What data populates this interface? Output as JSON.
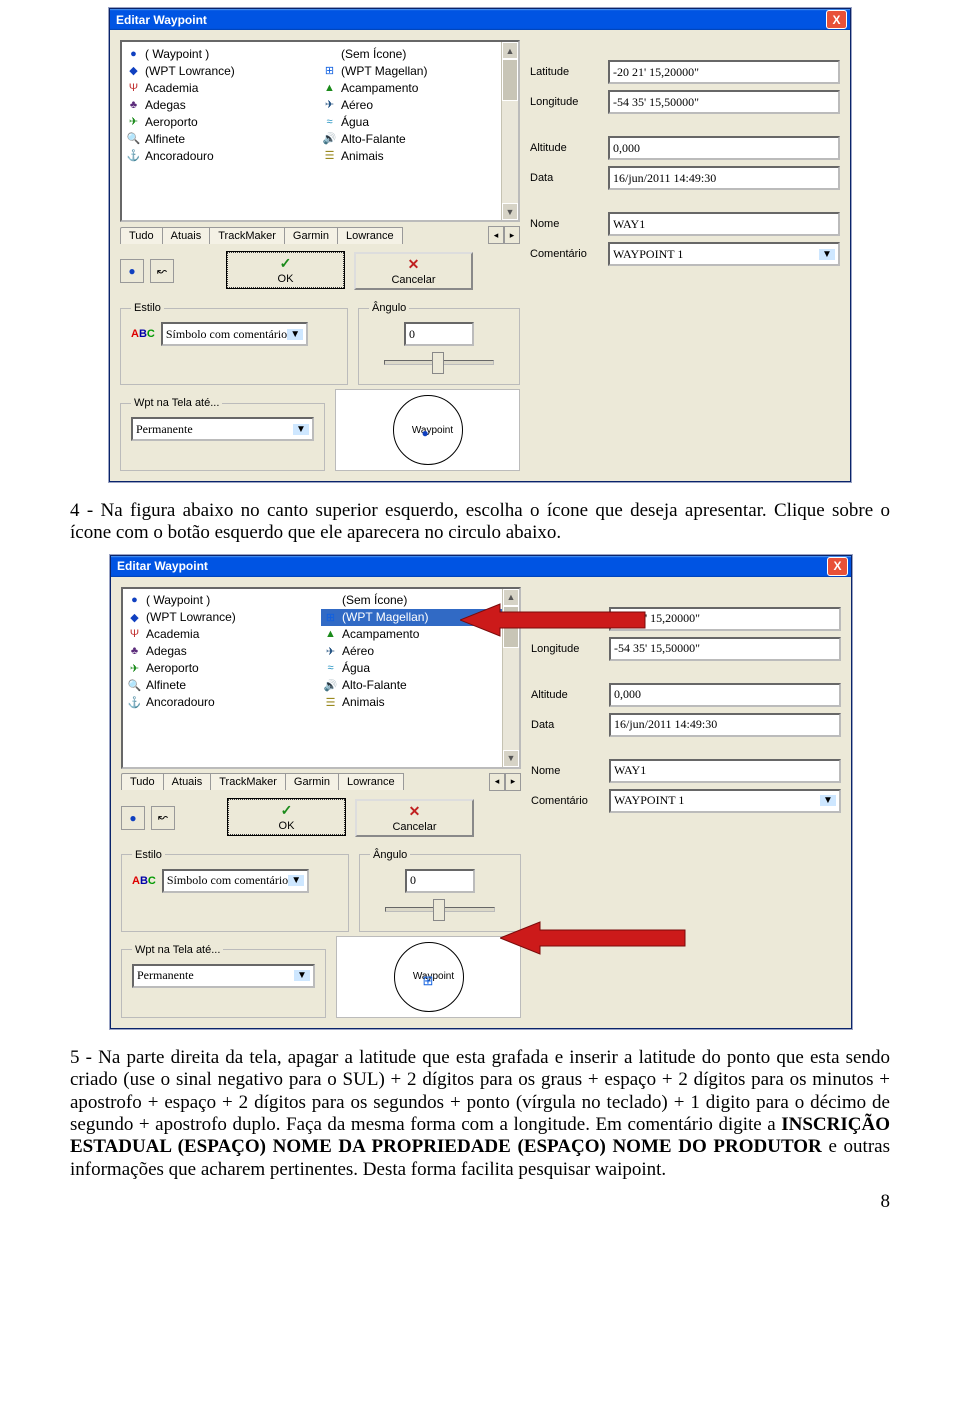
{
  "dialog": {
    "title": "Editar Waypoint",
    "close": "X",
    "iconList": [
      {
        "l_icon": "●",
        "l_label": "( Waypoint )",
        "l_color": "#1040c0",
        "r_icon": "",
        "r_label": "(Sem Ícone)",
        "r_color": ""
      },
      {
        "l_icon": "◆",
        "l_label": "(WPT Lowrance)",
        "l_color": "#1040c0",
        "r_icon": "⊞",
        "r_label": "(WPT Magellan)",
        "r_color": "#1060e0"
      },
      {
        "l_icon": "Ψ",
        "l_label": "Academia",
        "l_color": "#c03030",
        "r_icon": "▲",
        "r_label": "Acampamento",
        "r_color": "#1a8a1a"
      },
      {
        "l_icon": "♣",
        "l_label": "Adegas",
        "l_color": "#5a2a7a",
        "r_icon": "✈",
        "r_label": "Aéreo",
        "r_color": "#205080"
      },
      {
        "l_icon": "✈",
        "l_label": "Aeroporto",
        "l_color": "#1a8a1a",
        "r_icon": "≈",
        "r_label": "Água",
        "r_color": "#2090c0"
      },
      {
        "l_icon": "🔍",
        "l_label": "Alfinete",
        "l_color": "#c02020",
        "r_icon": "🔊",
        "r_label": "Alto-Falante",
        "r_color": "#2a9a2a"
      },
      {
        "l_icon": "⚓",
        "l_label": "Ancoradouro",
        "l_color": "#1040a0",
        "r_icon": "☰",
        "r_label": "Animais",
        "r_color": "#9a8a20"
      }
    ],
    "tabs": [
      "Tudo",
      "Atuais",
      "TrackMaker",
      "Garmin",
      "Lowrance"
    ],
    "ok": "OK",
    "cancel": "Cancelar",
    "form": {
      "latitude_label": "Latitude",
      "latitude_value": "-20 21' 15,20000\"",
      "longitude_label": "Longitude",
      "longitude_value": "-54 35' 15,50000\"",
      "altitude_label": "Altitude",
      "altitude_value": "0,000",
      "data_label": "Data",
      "data_value": "16/jun/2011 14:49:30",
      "nome_label": "Nome",
      "nome_value": "WAY1",
      "comentario_label": "Comentário",
      "comentario_value": "WAYPOINT 1"
    },
    "estilo": {
      "legend": "Estilo",
      "value": "Símbolo com comentário"
    },
    "angulo": {
      "legend": "Ângulo",
      "value": "0"
    },
    "wpt": {
      "legend": "Wpt na Tela até...",
      "value": "Permanente"
    },
    "preview_label": "Waypoint"
  },
  "text": {
    "para4": "4 - Na figura abaixo no canto superior esquerdo, escolha o ícone que deseja apresentar. Clique sobre o ícone com o botão esquerdo que ele aparecera no circulo abaixo.",
    "para5_before": "5 - Na parte direita da tela, apagar a latitude que esta grafada e inserir a latitude do ponto que esta sendo criado (use o sinal negativo para o SUL) + 2 dígitos para os graus + espaço + 2 dígitos para os minutos + apostrofo + espaço + 2 dígitos para os segundos + ponto (vírgula no teclado) + 1 digito para o décimo de segundo + apostrofo duplo. Faça da mesma forma com a longitude. Em comentário digite a ",
    "para5_bold": "INSCRIÇÃO ESTADUAL (ESPAÇO) NOME DA PROPRIEDADE (ESPAÇO) NOME DO PRODUTOR",
    "para5_after": " e outras informações que acharem pertinentes. Desta forma facilita pesquisar waipoint.",
    "pagenum": "8"
  }
}
